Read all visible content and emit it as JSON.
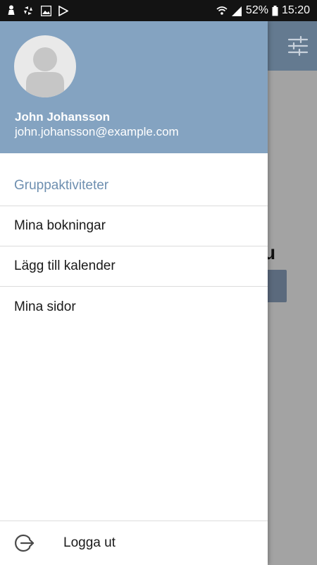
{
  "status_bar": {
    "battery": "52%",
    "time": "15:20"
  },
  "user": {
    "name": "John Johansson",
    "email": "john.johansson@example.com"
  },
  "menu": {
    "items": [
      {
        "label": "Gruppaktiviteter",
        "active": true
      },
      {
        "label": "Mina bokningar",
        "active": false
      },
      {
        "label": "Lägg till kalender",
        "active": false
      },
      {
        "label": "Mina sidor",
        "active": false
      }
    ]
  },
  "footer": {
    "logout_label": "Logga ut"
  },
  "icons": {
    "avatar": "person-placeholder-icon",
    "logout": "logout-icon",
    "filter": "sliders-icon"
  },
  "colors": {
    "header": "#84a3c1",
    "accent": "#6e8fb0",
    "toolbar": "#647a90",
    "status_bar": "#131313"
  }
}
